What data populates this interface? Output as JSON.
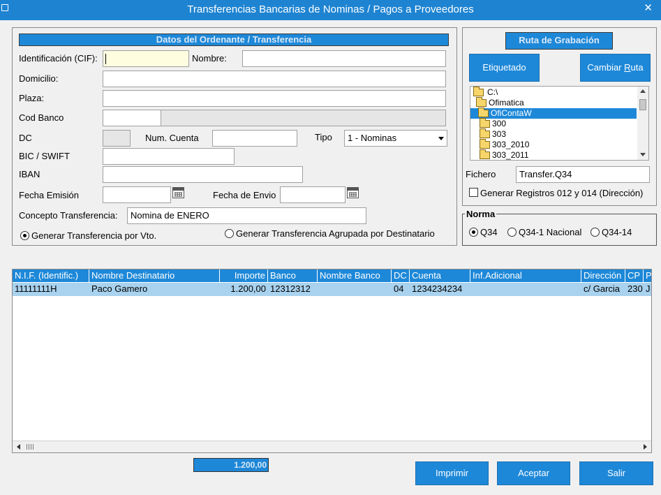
{
  "window": {
    "title": "Transferencias Bancarias de Nominas / Pagos a Proveedores",
    "close_glyph": "✕"
  },
  "ordenante": {
    "header": "Datos del Ordenante / Transferencia",
    "cif_label": "Identificación (CIF):",
    "cif_value": "",
    "nombre_label": "Nombre:",
    "nombre_value": "",
    "domicilio_label": "Domicilio:",
    "domicilio_value": "",
    "plaza_label": "Plaza:",
    "plaza_value": "",
    "codbanco_label": "Cod Banco",
    "codbanco_value": "",
    "codbanco_name": "",
    "dc_label": "DC",
    "dc_value": "",
    "numcuenta_label": "Num. Cuenta",
    "numcuenta_value": "",
    "tipo_label": "Tipo",
    "tipo_value": "1 - Nominas",
    "bic_label": "BIC / SWIFT",
    "bic_value": "",
    "iban_label": "IBAN",
    "iban_value": "",
    "fecha_emision_label": "Fecha Emisión",
    "fecha_emision_value": "",
    "fecha_envio_label": "Fecha de Envio",
    "fecha_envio_value": "",
    "concepto_label": "Concepto Transferencia:",
    "concepto_value": "Nomina de ENERO",
    "radio_vto": "Generar Transferencia por Vto.",
    "radio_agrupada": "Generar Transferencia Agrupada por Destinatario"
  },
  "ruta": {
    "header": "Ruta de Grabación",
    "etiquetado_button": "Etiquetado",
    "cambiar_button_pre": "Cambiar ",
    "cambiar_button_accel": "R",
    "cambiar_button_post": "uta",
    "tree": [
      {
        "label": "C:\\",
        "open": true,
        "selected": false
      },
      {
        "label": "Ofimatica",
        "open": true,
        "selected": false
      },
      {
        "label": "OfiContaW",
        "open": true,
        "selected": true
      },
      {
        "label": "300",
        "open": false,
        "selected": false
      },
      {
        "label": "303",
        "open": false,
        "selected": false
      },
      {
        "label": "303_2010",
        "open": false,
        "selected": false
      },
      {
        "label": "303_2011",
        "open": false,
        "selected": false
      }
    ],
    "fichero_label": "Fichero",
    "fichero_value": "Transfer.Q34",
    "generar_registros_label": "Generar Registros 012 y 014 (Dirección)"
  },
  "norma": {
    "legend": "Norma",
    "options": [
      "Q34",
      "Q34-1 Nacional",
      "Q34-14"
    ],
    "selected": "Q34"
  },
  "grid": {
    "columns": [
      "N.I.F. (Identific.)",
      "Nombre Destinatario",
      "Importe",
      "Banco",
      "Nombre Banco",
      "DC",
      "Cuenta",
      "Inf.Adicional",
      "Dirección",
      "CP",
      "P"
    ],
    "rows": [
      {
        "nif": "11111111H",
        "nombre": "Paco Gamero",
        "importe": "1.200,00",
        "banco": "12312312",
        "nombre_banco": "",
        "dc": "04",
        "cuenta": "1234234234",
        "inf": "",
        "direccion": "c/ Garcia",
        "cp": "230",
        "p": "J"
      }
    ]
  },
  "footer": {
    "total": "1.200,00",
    "imprimir": "Imprimir",
    "aceptar": "Aceptar",
    "salir": "Salir"
  },
  "colors": {
    "accent": "#1e88d8",
    "titlebar": "#1e84d2",
    "row_selected": "#a8d2ee"
  }
}
